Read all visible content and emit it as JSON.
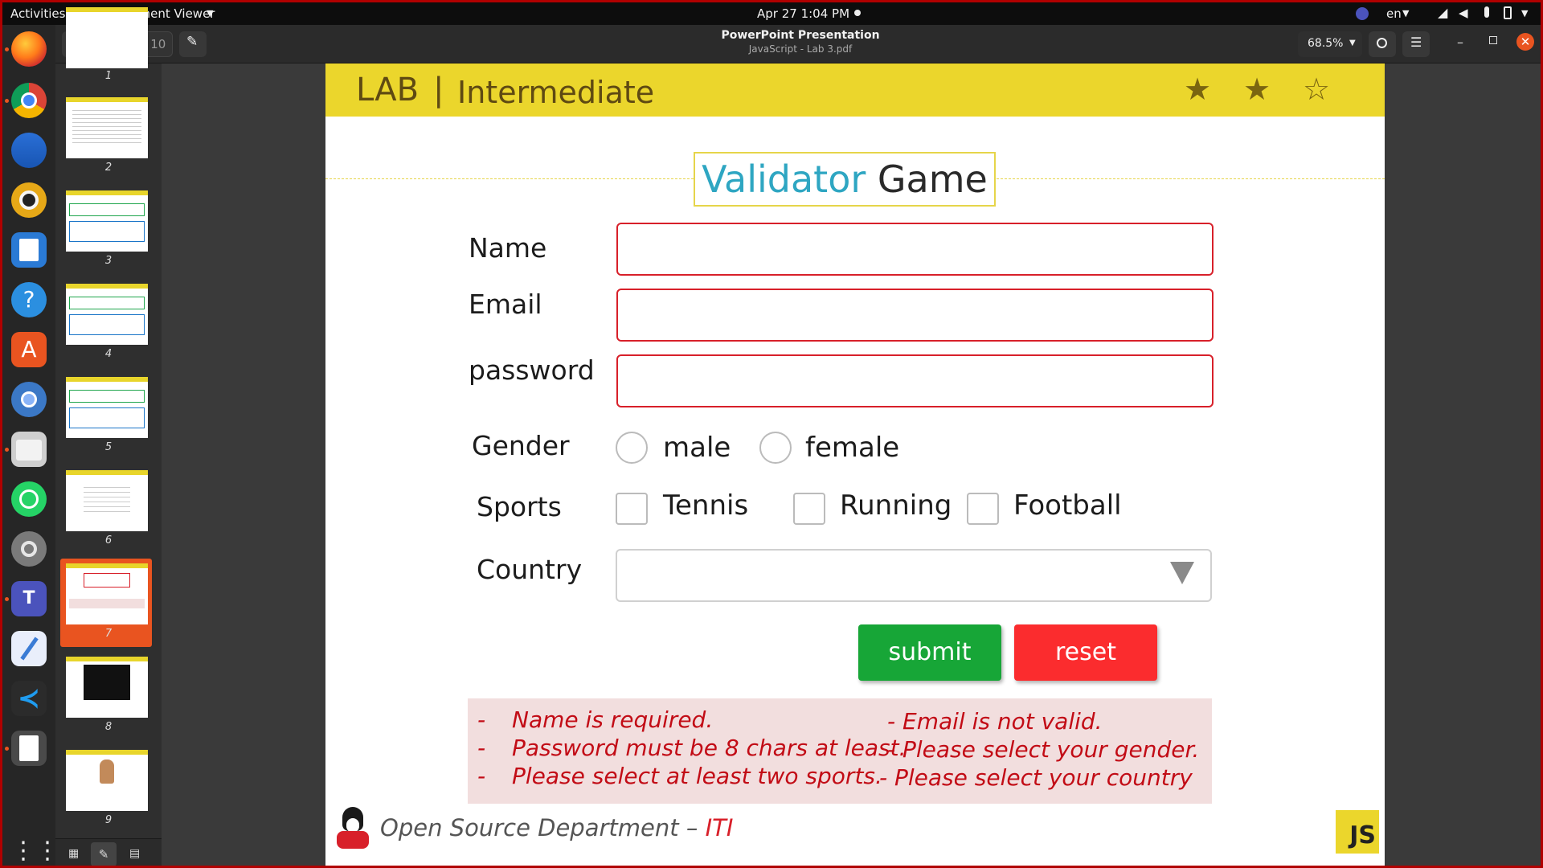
{
  "system_bar": {
    "activities": "Activities",
    "app_menu": "Document Viewer",
    "datetime": "Apr 27  1:04 PM",
    "language": "en"
  },
  "viewer_header": {
    "page_current": "7",
    "page_total": "of 10",
    "title": "PowerPoint Presentation",
    "subtitle": "JavaScript - Lab 3.pdf",
    "zoom": "68.5%"
  },
  "sidebar": {
    "thumbnails": [
      {
        "number": "1"
      },
      {
        "number": "2"
      },
      {
        "number": "3"
      },
      {
        "number": "4"
      },
      {
        "number": "5"
      },
      {
        "number": "6"
      },
      {
        "number": "7",
        "selected": true
      },
      {
        "number": "8"
      },
      {
        "number": "9"
      }
    ]
  },
  "slide": {
    "lab": "LAB",
    "separator": "|",
    "level": "Intermediate",
    "rating": {
      "filled": 2,
      "total": 3
    },
    "title_part1": "Validator",
    "title_part2": "Game",
    "form": {
      "name_label": "Name",
      "email_label": "Email",
      "password_label": "password",
      "gender_label": "Gender",
      "gender_options": [
        "male",
        "female"
      ],
      "sports_label": "Sports",
      "sports_options": [
        "Tennis",
        "Running",
        "Football"
      ],
      "country_label": "Country",
      "submit": "submit",
      "reset": "reset"
    },
    "errors": {
      "left": [
        "Name is required.",
        "Password must be 8 chars at least.",
        "Please select at least two sports."
      ],
      "right": [
        "- Email is not valid.",
        "- Please select your gender.",
        "- Please select your country"
      ],
      "bullet": "-"
    },
    "footer_text": "Open Source Department – ",
    "footer_org": "ITI",
    "badge": "JS"
  },
  "colors": {
    "band": "#ebd62c",
    "title_blue": "#2ea6c2",
    "submit_green": "#17a637",
    "reset_red": "#fb2c2e",
    "error_text": "#c20c16",
    "error_bg": "#f2dede",
    "selected_thumb": "#e95420"
  }
}
